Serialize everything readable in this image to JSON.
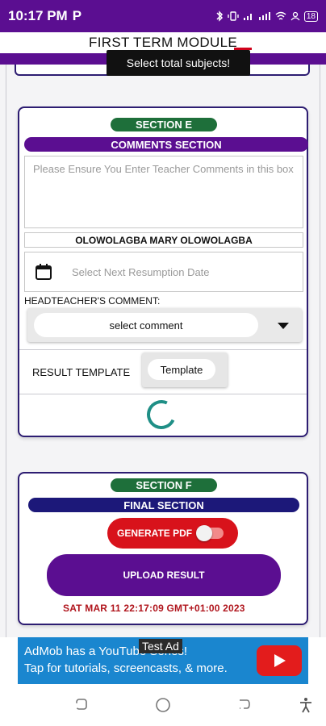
{
  "status_bar": {
    "time": "10:17 PM",
    "p_icon": "P",
    "battery": "18"
  },
  "header": {
    "title": "FIRST TERM MODULE"
  },
  "toast": {
    "message": "Select total subjects!"
  },
  "section_e": {
    "badge": "SECTION E",
    "heading": "COMMENTS SECTION",
    "teacher_comment_placeholder": "Please Ensure You Enter Teacher Comments in this box",
    "teacher_name": "OLOWOLAGBA MARY OLOWOLAGBA",
    "resumption_placeholder": "Select Next Resumption Date",
    "headteacher_label": "HEADTEACHER'S COMMENT:",
    "headteacher_select": "select comment",
    "result_template_label": "RESULT TEMPLATE",
    "template_button": "Template"
  },
  "section_f": {
    "badge": "SECTION F",
    "heading": "FINAL SECTION",
    "generate_pdf": "GENERATE PDF",
    "generate_pdf_on": false,
    "upload_button": "UPLOAD RESULT",
    "timestamp": "SAT MAR 11 22:17:09 GMT+01:00 2023"
  },
  "ad": {
    "label": "Test Ad",
    "line1": "AdMob has a YouTube Series!",
    "line2": "Tap for tutorials, screencasts, & more."
  },
  "colors": {
    "primary_purple": "#5b0e91",
    "section_green": "#1e6f3a",
    "final_navy": "#1c1879",
    "danger_red": "#d8121b",
    "ad_blue": "#1a86cf"
  },
  "icons": [
    "calendar-icon",
    "dropdown-arrow-icon",
    "youtube-play-icon",
    "recent-apps-icon",
    "home-icon",
    "back-icon",
    "accessibility-icon"
  ]
}
